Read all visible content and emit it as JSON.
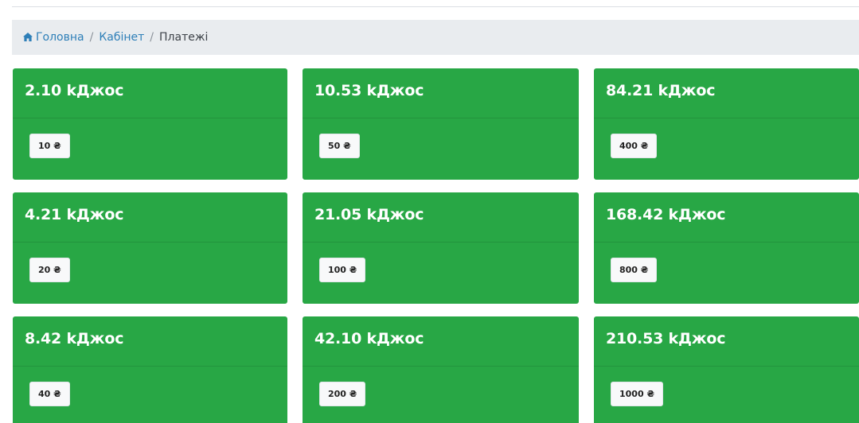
{
  "breadcrumb": {
    "home": "Головна",
    "cabinet": "Кабінет",
    "current": "Платежі",
    "separator": "/"
  },
  "colors": {
    "card_green": "#28a745",
    "breadcrumb_bg": "#e9ecef",
    "link_blue": "#2e7fb8"
  },
  "cards": [
    {
      "amount": "2.10 kДжос",
      "price": "10 ₴"
    },
    {
      "amount": "10.53 kДжос",
      "price": "50 ₴"
    },
    {
      "amount": "84.21 kДжос",
      "price": "400 ₴"
    },
    {
      "amount": "4.21 kДжос",
      "price": "20 ₴"
    },
    {
      "amount": "21.05 kДжос",
      "price": "100 ₴"
    },
    {
      "amount": "168.42 kДжос",
      "price": "800 ₴"
    },
    {
      "amount": "8.42 kДжос",
      "price": "40 ₴"
    },
    {
      "amount": "42.10 kДжос",
      "price": "200 ₴"
    },
    {
      "amount": "210.53 kДжос",
      "price": "1000 ₴"
    }
  ]
}
